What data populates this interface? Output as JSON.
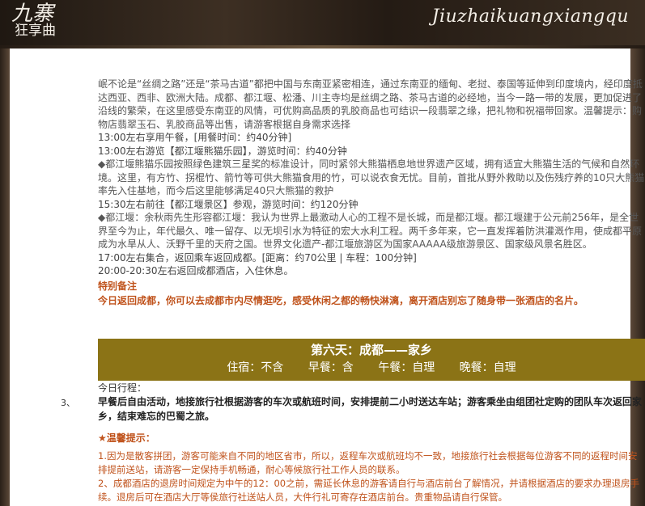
{
  "header": {
    "logo_big": "九寨",
    "logo_small": "狂享曲",
    "logo_script": "Jiuzhaikuangxiangqu"
  },
  "intro": {
    "p1": "岷不论是“丝绸之路”还是“茶马古道”都把中国与东南亚紧密相连，通过东南亚的缅甸、老挝、泰国等延伸到印度境内，经印度抵达西亚、西非、欧洲大陆。成都、都江堰、松潘、川主寺均是丝绸之路、茶马古道的必经地，当今一路一带的发展，更加促进了沿线的繁荣，在这里感受东南亚的风情，可优购高品质的乳胶商品也可结识一段翡翠之缘，把礼物和祝福带回家。温馨提示：购物店翡翠玉石、乳胶商品等出售，请游客根据自身需求选择"
  },
  "schedule": [
    "13:00左右享用午餐，[用餐时间：约40分钟]",
    "13:00左右游览【都江堰熊猫乐园】，游览时间：约40分钟",
    "◆都江堰熊猫乐园按照绿色建筑三星奖的标准设计，同时紧邻大熊猫栖息地世界遗产区域，拥有适宜大熊猫生活的气候和自然环境。这里，有方竹、拐棍竹、箭竹等可供大熊猫食用的竹，可以说衣食无忧。目前，首批从野外救助以及伤残疗养的10只大熊猫率先入住基地，而今后这里能够满足40只大熊猫的救护",
    "15:30左右前往【都江堰景区】参观，游览时间：约120分钟",
    "◆都江堰：余秋雨先生形容都江堰：我认为世界上最激动人心的工程不是长城，而是都江堰。都江堰建于公元前256年，是全世界至今为止，年代最久、唯一留存、以无坝引水为特征的宏大水利工程。两千多年来，它一直发挥着防洪灌溉作用，使成都平原成为水旱从人、沃野千里的天府之国。世界文化遗产-都江堰旅游区为国家AAAAA级旅游景区、国家级风景名胜区。",
    "17:00左右集合，返回乘车返回成都。[距离：约70公里 | 车程：100分钟]",
    "20:00-20:30左右返回成都酒店，入住休息。"
  ],
  "notice": {
    "title": "特别备注",
    "body": "今日返回成都，你可以去成都市内尽情逛吃，感受休闲之都的畅快淋漓，离开酒店别忘了随身带一张酒店的名片。"
  },
  "day6": {
    "title": "第六天：成都——家乡",
    "lodging": "住宿：不含",
    "breakfast": "早餐：含",
    "lunch": "午餐：自理",
    "dinner": "晚餐：自理"
  },
  "today": {
    "label": "今日行程：",
    "number": "3、",
    "body": "早餐后自由活动，地接旅行社根据游客的车次或航班时间，安排提前二小时送达车站；游客乘坐由组团社定购的团队车次返回家乡，结束难忘的巴蜀之旅。"
  },
  "tips": {
    "title": "★温馨提示：",
    "t1": "1.因为是散客拼团，游客可能来自不同的地区省市，所以，返程车次或航班均不一致，地接旅行社会根据每位游客不同的返程时间安排提前送站，请游客一定保持手机畅通，耐心等候旅行社工作人员的联系。",
    "t2": "2、成都酒店的退房时间规定为中午的12：00之前，需延长休息的游客请自行与酒店前台了解情况，并请根据酒店的要求办理退房手续。退房后可在酒店大厅等侯旅行社送站人员，大件行礼可寄存在酒店前台。贵重物品请自行保管。"
  },
  "colors": {
    "accent_orange": "#c0531c",
    "day_bar": "#8b7316",
    "frame": "#2b2119"
  }
}
